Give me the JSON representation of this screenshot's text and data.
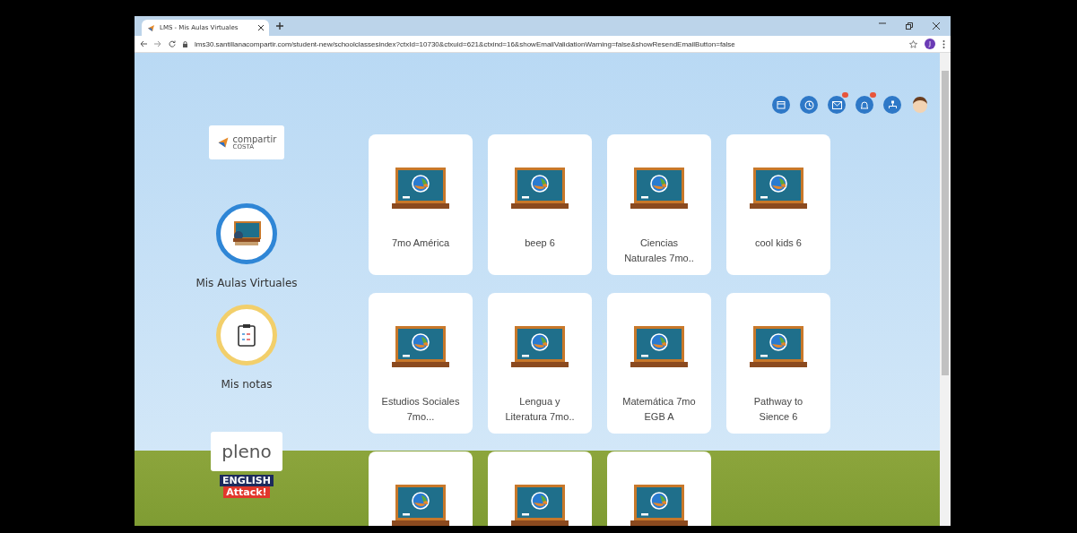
{
  "browser": {
    "tab_title": "LMS - Mis Aulas Virtuales",
    "url": "lms30.santillanacompartir.com/student-new/schoolclassesindex?ctxId=10730&ctxuid=621&ctxind=16&showEmailValidationWarning=false&showResendEmailButton=false",
    "profile_initial": "J"
  },
  "sidebar": {
    "logo_text": "compartir",
    "logo_subtext": "COSTA",
    "nav": [
      {
        "label": "Mis Aulas Virtuales",
        "kind": "classes",
        "color": "#2f86d6"
      },
      {
        "label": "Mis notas",
        "kind": "grades",
        "color": "#f2cf6b"
      }
    ],
    "partners": [
      {
        "kind": "pleno",
        "text": "pleno"
      },
      {
        "kind": "english",
        "text": "ENGLISH",
        "subtext": "Attack!"
      }
    ]
  },
  "toolbar_icons": [
    {
      "kind": "calendar",
      "badge": false
    },
    {
      "kind": "clock",
      "badge": false
    },
    {
      "kind": "mail",
      "badge": true
    },
    {
      "kind": "bell",
      "badge": true
    },
    {
      "kind": "network",
      "badge": false
    },
    {
      "kind": "avatar",
      "badge": false
    }
  ],
  "classes": [
    {
      "label": "7mo América"
    },
    {
      "label": "beep 6"
    },
    {
      "label": "Ciencias Naturales 7mo.."
    },
    {
      "label": "cool kids 6"
    },
    {
      "label": "Estudios Sociales 7mo..."
    },
    {
      "label": "Lengua y Literatura 7mo.."
    },
    {
      "label": "Matemática 7mo EGB A"
    },
    {
      "label": "Pathway to Sience 6"
    },
    {
      "kind": "unlabeled"
    },
    {
      "kind": "unlabeled"
    },
    {
      "kind": "unlabeled"
    }
  ]
}
